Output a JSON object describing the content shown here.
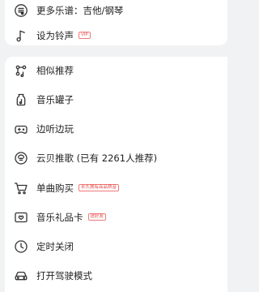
{
  "menu_top": [
    {
      "name": "more-sheet-music",
      "icon": "sheet-music-icon",
      "label": "更多乐谱：吉他/钢琴",
      "tag": ""
    },
    {
      "name": "set-ringtone",
      "icon": "music-note-icon",
      "label": "设为铃声",
      "tag": "VIP"
    }
  ],
  "menu_main": [
    {
      "name": "similar-recommend",
      "icon": "similar-icon",
      "label": "相似推荐",
      "tag": ""
    },
    {
      "name": "music-jar",
      "icon": "jar-icon",
      "label": "音乐罐子",
      "tag": ""
    },
    {
      "name": "listen-and-play",
      "icon": "gamepad-icon",
      "label": "边听边玩",
      "tag": ""
    },
    {
      "name": "yunbei-recommend",
      "icon": "yunbei-icon",
      "label": "云贝推歌 (已有 2261人推荐)",
      "tag": ""
    },
    {
      "name": "buy-single",
      "icon": "cart-icon",
      "label": "单曲购买",
      "tag": "永久拥有高品质音"
    },
    {
      "name": "music-gift-card",
      "icon": "gift-card-icon",
      "label": "音乐礼品卡",
      "tag": "送好友"
    },
    {
      "name": "sleep-timer",
      "icon": "clock-icon",
      "label": "定时关闭",
      "tag": ""
    },
    {
      "name": "driving-mode",
      "icon": "car-icon",
      "label": "打开驾驶模式",
      "tag": ""
    }
  ]
}
